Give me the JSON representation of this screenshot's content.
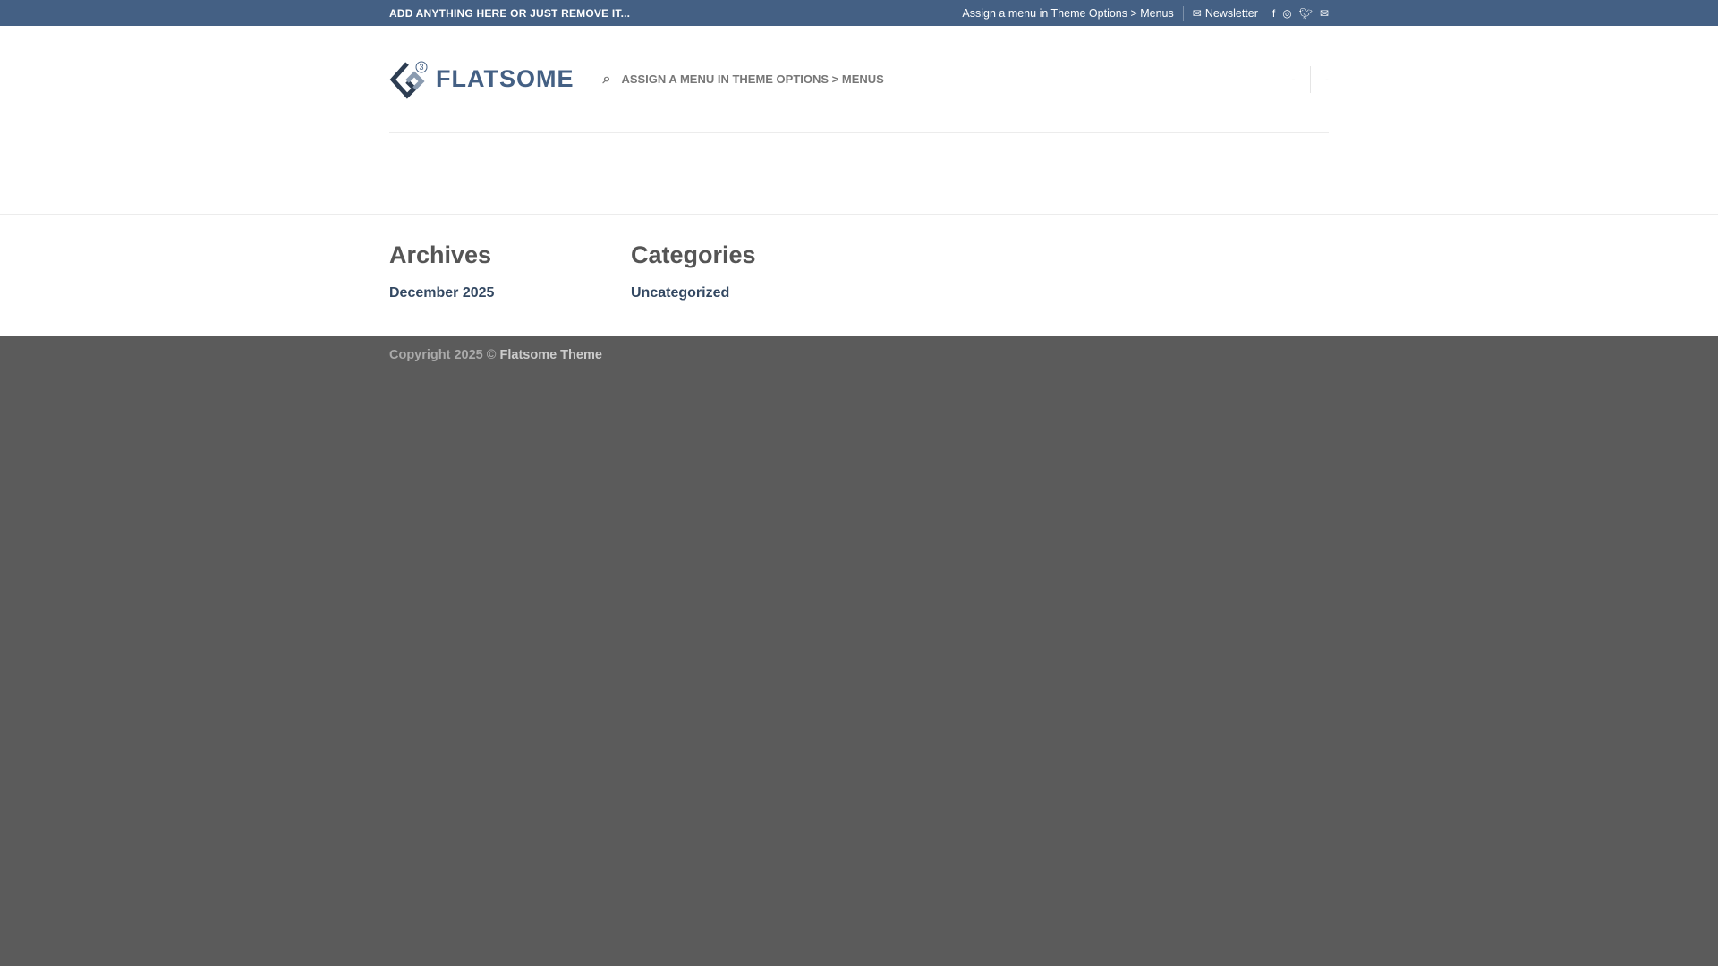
{
  "topbar": {
    "left_text": "ADD ANYTHING HERE OR JUST REMOVE IT...",
    "menu_hint": "Assign a menu in Theme Options > Menus",
    "newsletter": "Newsletter",
    "social": [
      "facebook-icon",
      "instagram-icon",
      "twitter-icon",
      "envelope-icon"
    ]
  },
  "header": {
    "logo_text": "FLATSOME",
    "logo_badge": "3",
    "nav_text": "ASSIGN A MENU IN THEME OPTIONS > MENUS",
    "right_items": [
      "-",
      "-"
    ]
  },
  "widgets": [
    {
      "title": "Archives",
      "link": "December 2025"
    },
    {
      "title": "Categories",
      "link": "Uncategorized"
    }
  ],
  "footer": {
    "copyright": "Copyright 2025 ©",
    "brand": "Flatsome Theme"
  },
  "colors": {
    "primary": "#446084",
    "link": "#334862",
    "footer": "#5b5b5b"
  }
}
